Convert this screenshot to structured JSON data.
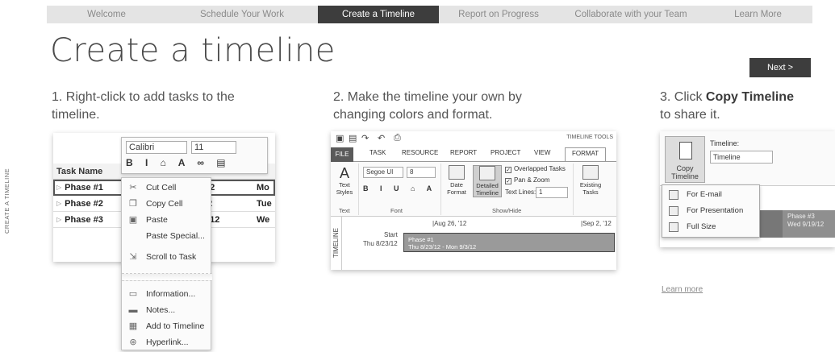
{
  "nav": {
    "items": [
      "Welcome",
      "Schedule Your Work",
      "Create a Timeline",
      "Report on Progress",
      "Collaborate with your Team",
      "Learn More"
    ],
    "active_index": 2
  },
  "side_label": "CREATE A TIMELINE",
  "page_title": "Create a timeline",
  "next_button": "Next >",
  "steps": {
    "s1_line1": "1. Right-click to add tasks to the",
    "s1_line2": "timeline.",
    "s2_line1": "2. Make the timeline your own by",
    "s2_line2": "changing colors and format.",
    "s3_prefix": "3. Click ",
    "s3_bold": "Copy Timeline",
    "s3_line2": "to share it."
  },
  "panel1": {
    "mini_toolbar": {
      "font": "Calibri",
      "size": "11"
    },
    "grid": {
      "header": "Task Name",
      "rows": [
        {
          "name": "Phase #1",
          "c2": "/12",
          "c3": "Mo"
        },
        {
          "name": "Phase #2",
          "c2": "12",
          "c3": "Tue"
        },
        {
          "name": "Phase #3",
          "c2": "9/12",
          "c3": "We"
        }
      ]
    },
    "menu": {
      "cut": "Cut Cell",
      "copy": "Copy Cell",
      "paste": "Paste",
      "paste_special": "Paste Special...",
      "scroll": "Scroll to Task",
      "information": "Information...",
      "notes": "Notes...",
      "add_timeline": "Add to Timeline",
      "hyperlink": "Hyperlink..."
    }
  },
  "panel2": {
    "timeline_tools": "TIMELINE TOOLS",
    "tabs": [
      "FILE",
      "TASK",
      "RESOURCE",
      "REPORT",
      "PROJECT",
      "VIEW",
      "FORMAT"
    ],
    "font": "Segoe UI",
    "size": "8",
    "text_styles": "Text Styles",
    "date_format": "Date Format",
    "detailed_timeline": "Detailed Timeline",
    "overlapped": "Overlapped Tasks",
    "pan_zoom": "Pan & Zoom",
    "text_lines_label": "Text Lines:",
    "text_lines_value": "1",
    "existing_tasks": "Existing Tasks",
    "groups": [
      "Text",
      "Font",
      "Show/Hide"
    ],
    "timeline_label": "TIMELINE",
    "start_label": "Start",
    "start_date": "Thu 8/23/12",
    "date1": "Aug 26, '12",
    "date2": "Sep 2, '12",
    "bar_title": "Phase #1",
    "bar_dates": "Thu 8/23/12 - Mon 9/3/12"
  },
  "panel3": {
    "copy_label": "Copy Timeline",
    "timeline_label": "Timeline:",
    "timeline_value": "Timeline",
    "menu": [
      "For E-mail",
      "For Presentation",
      "Full Size"
    ],
    "phase_title": "Phase #3",
    "phase_date": "Wed 9/19/12"
  },
  "learn_more": "Learn more"
}
